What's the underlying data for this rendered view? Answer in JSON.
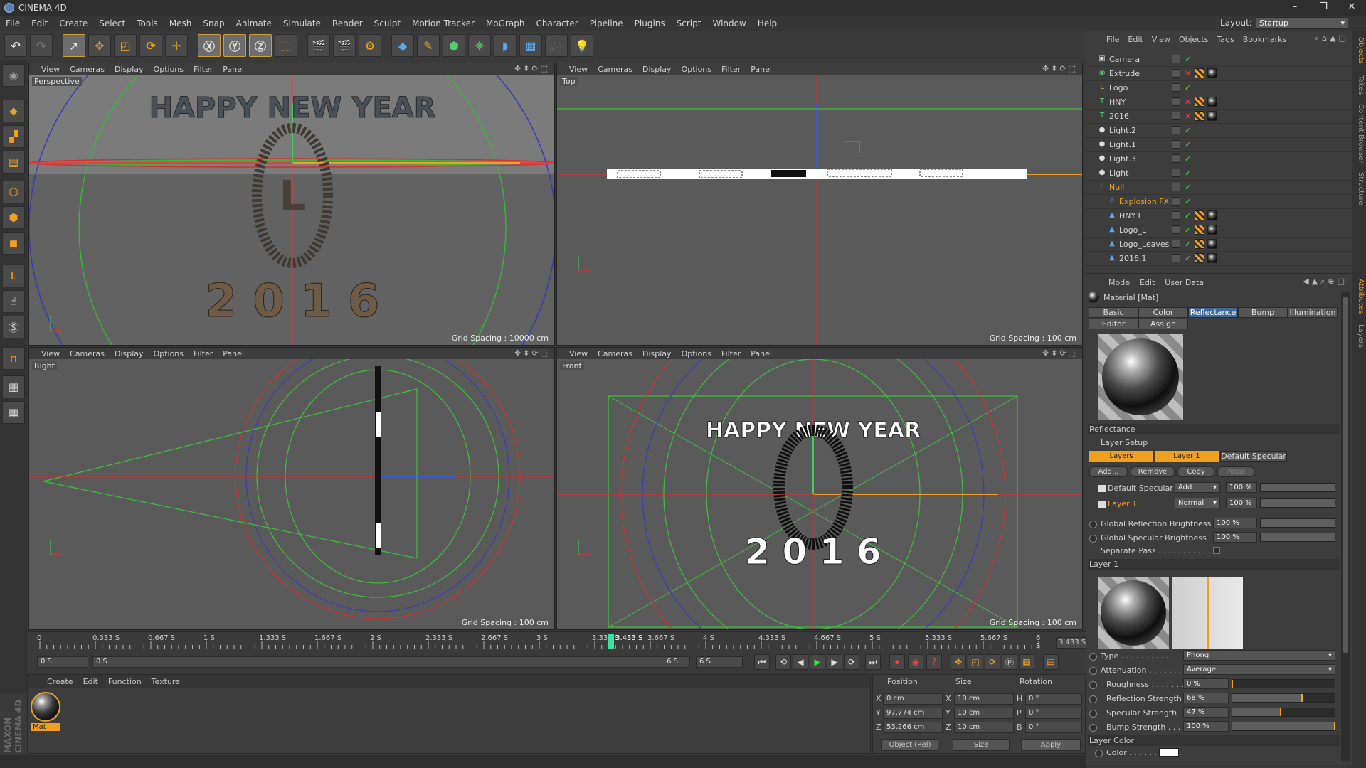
{
  "app": {
    "title": "CINEMA 4D"
  },
  "menu": [
    "File",
    "Edit",
    "Create",
    "Select",
    "Tools",
    "Mesh",
    "Snap",
    "Animate",
    "Simulate",
    "Render",
    "Sculpt",
    "Motion Tracker",
    "MoGraph",
    "Character",
    "Pipeline",
    "Plugins",
    "Script",
    "Window",
    "Help"
  ],
  "layout": {
    "label": "Layout:",
    "value": "Startup"
  },
  "viewport_menu": [
    "View",
    "Cameras",
    "Display",
    "Options",
    "Filter",
    "Panel"
  ],
  "viewports": {
    "perspective": {
      "label": "Perspective",
      "grid": "Grid Spacing : 10000 cm",
      "text1": "HAPPY NEW YEAR",
      "text2": "2  0  1  6"
    },
    "top": {
      "label": "Top",
      "grid": "Grid Spacing : 100 cm"
    },
    "right": {
      "label": "Right",
      "grid": "Grid Spacing : 100 cm"
    },
    "front": {
      "label": "Front",
      "grid": "Grid Spacing : 100 cm",
      "text1": "HAPPY NEW YEAR",
      "text2": "2  0  1  6"
    }
  },
  "timeline": {
    "ticks": [
      "0",
      "0.333 S",
      "0.667 S",
      "1 S",
      "1.333 S",
      "1.667 S",
      "2 S",
      "2.333 S",
      "2.667 S",
      "3 S",
      "3.333 S",
      "3.433 S",
      "3.667 S",
      "4 S",
      "4.333 S",
      "4.667 S",
      "5 S",
      "5.333 S",
      "5.667 S",
      "6 S"
    ],
    "current": "3.433 S",
    "current_frac": 0.572
  },
  "transport": {
    "start": "0 S",
    "start2": "0 S",
    "end": "6 S",
    "end2": "6 S"
  },
  "material_manager": {
    "menu": [
      "Create",
      "Edit",
      "Function",
      "Texture"
    ],
    "material": "Mat"
  },
  "coords": {
    "headers": [
      "Position",
      "Size",
      "Rotation"
    ],
    "rows": [
      {
        "axis": "X",
        "pos": "0 cm",
        "saxis": "X",
        "size": "10 cm",
        "raxis": "H",
        "rot": "0 °"
      },
      {
        "axis": "Y",
        "pos": "97.774 cm",
        "saxis": "Y",
        "size": "10 cm",
        "raxis": "P",
        "rot": "0 °"
      },
      {
        "axis": "Z",
        "pos": "53.266 cm",
        "saxis": "Z",
        "size": "10 cm",
        "raxis": "B",
        "rot": "0 °"
      }
    ],
    "mode": "Object (Rel)",
    "size_mode": "Size",
    "apply": "Apply"
  },
  "maxon": {
    "line1": "MAXON",
    "line2": "CINEMA 4D"
  },
  "object_manager": {
    "menu": [
      "File",
      "Edit",
      "View",
      "Objects",
      "Tags",
      "Bookmarks"
    ],
    "objects": [
      {
        "name": "Camera",
        "icon": "camera-icon",
        "indent": 0
      },
      {
        "name": "Extrude",
        "icon": "extrude-icon",
        "indent": 0
      },
      {
        "name": "Logo",
        "icon": "null-icon",
        "indent": 0
      },
      {
        "name": "HNY",
        "icon": "text-icon",
        "indent": 0
      },
      {
        "name": "2016",
        "icon": "text-icon",
        "indent": 0
      },
      {
        "name": "Light.2",
        "icon": "light-icon",
        "indent": 0
      },
      {
        "name": "Light.1",
        "icon": "light-icon",
        "indent": 0
      },
      {
        "name": "Light.3",
        "icon": "light-icon",
        "indent": 0
      },
      {
        "name": "Light",
        "icon": "light-icon",
        "indent": 0
      },
      {
        "name": "Null",
        "icon": "null-icon",
        "indent": 0
      },
      {
        "name": "Explosion FX",
        "icon": "explosion-icon",
        "indent": 1
      },
      {
        "name": "HNY.1",
        "icon": "polygon-icon",
        "indent": 1
      },
      {
        "name": "Logo_L",
        "icon": "polygon-icon",
        "indent": 1
      },
      {
        "name": "Logo_Leaves",
        "icon": "polygon-icon",
        "indent": 1
      },
      {
        "name": "2016.1",
        "icon": "polygon-icon",
        "indent": 1
      }
    ]
  },
  "attributes": {
    "menu": [
      "Mode",
      "Edit",
      "User Data"
    ],
    "title": "Material [Mat]",
    "tabs": [
      "Basic",
      "Color",
      "Reflectance",
      "Bump",
      "Illumination",
      "Editor",
      "Assign"
    ],
    "active_tab": "Reflectance",
    "section": "Reflectance",
    "layer_setup": "Layer Setup",
    "layer_tabs": [
      "Layers",
      "Layer 1",
      "Default Specular"
    ],
    "buttons": [
      "Add...",
      "Remove",
      "Copy",
      "Paste"
    ],
    "layers": [
      {
        "name": "Default Specular",
        "mode": "Add",
        "value": "100 %"
      },
      {
        "name": "Layer 1",
        "mode": "Normal",
        "value": "100 %"
      }
    ],
    "global_reflection": {
      "label": "Global Reflection Brightness",
      "value": "100 %"
    },
    "global_specular": {
      "label": "Global Specular Brightness",
      "value": "100 %"
    },
    "separate_pass": "Separate Pass . . . . . . . . . . . .",
    "layer1_header": "Layer 1",
    "type": {
      "label": "Type . . . . . . . . . . . . . . .",
      "value": "Phong"
    },
    "attenuation": {
      "label": "Attenuation . . . . . . . .",
      "value": "Average"
    },
    "roughness": {
      "label": "Roughness . . . . . . . . .",
      "value": "0 %",
      "frac": 0.0
    },
    "refl_strength": {
      "label": "Reflection Strength",
      "value": "68 %",
      "frac": 0.68
    },
    "spec_strength": {
      "label": "Specular Strength",
      "value": "47 %",
      "frac": 0.47
    },
    "bump_strength": {
      "label": "Bump Strength . . .",
      "value": "100 %",
      "frac": 1.0
    },
    "layer_color": "Layer Color",
    "color_label": "Color . . . . . . . . . . ."
  },
  "side_tabs": [
    "Objects",
    "Takes",
    "Content Browser",
    "Structure",
    "Attributes",
    "Layers"
  ]
}
